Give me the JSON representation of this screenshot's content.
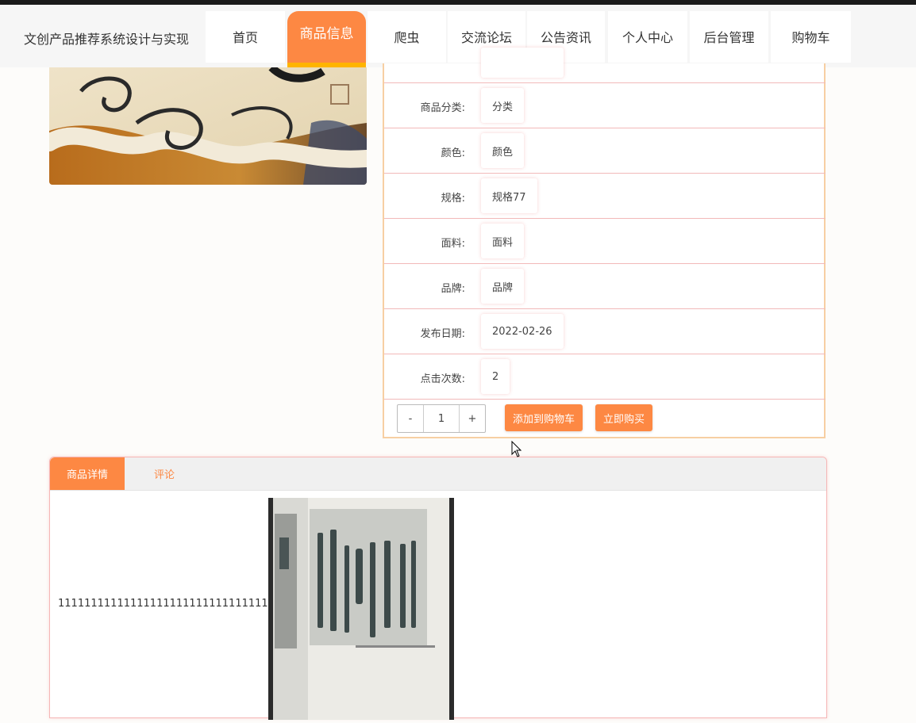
{
  "site": {
    "title": "文创产品推荐系统设计与实现"
  },
  "nav": {
    "items": [
      {
        "label": "首页"
      },
      {
        "label": "商品信息"
      },
      {
        "label": "爬虫"
      },
      {
        "label": "交流论坛"
      },
      {
        "label": "公告资讯"
      },
      {
        "label": "个人中心"
      },
      {
        "label": "后台管理"
      },
      {
        "label": "购物车"
      }
    ],
    "active_index": 1
  },
  "product": {
    "fields": [
      {
        "label": "商品分类:",
        "value": "分类"
      },
      {
        "label": "颜色:",
        "value": "颜色"
      },
      {
        "label": "规格:",
        "value": "规格77"
      },
      {
        "label": "面料:",
        "value": "面料"
      },
      {
        "label": "品牌:",
        "value": "品牌"
      },
      {
        "label": "发布日期:",
        "value": "2022-02-26"
      },
      {
        "label": "点击次数:",
        "value": "2"
      }
    ],
    "quantity": {
      "minus": "-",
      "value": "1",
      "plus": "+"
    },
    "add_to_cart": "添加到购物车",
    "buy_now": "立即购买"
  },
  "detail": {
    "tabs": [
      {
        "label": "商品详情"
      },
      {
        "label": "评论"
      }
    ],
    "active_tab": 0,
    "content_text": "1111111111111111111111111111111111111"
  },
  "colors": {
    "accent": "#fd8843",
    "active_underline": "#ffb400",
    "row_border": "#f2b9b9"
  }
}
